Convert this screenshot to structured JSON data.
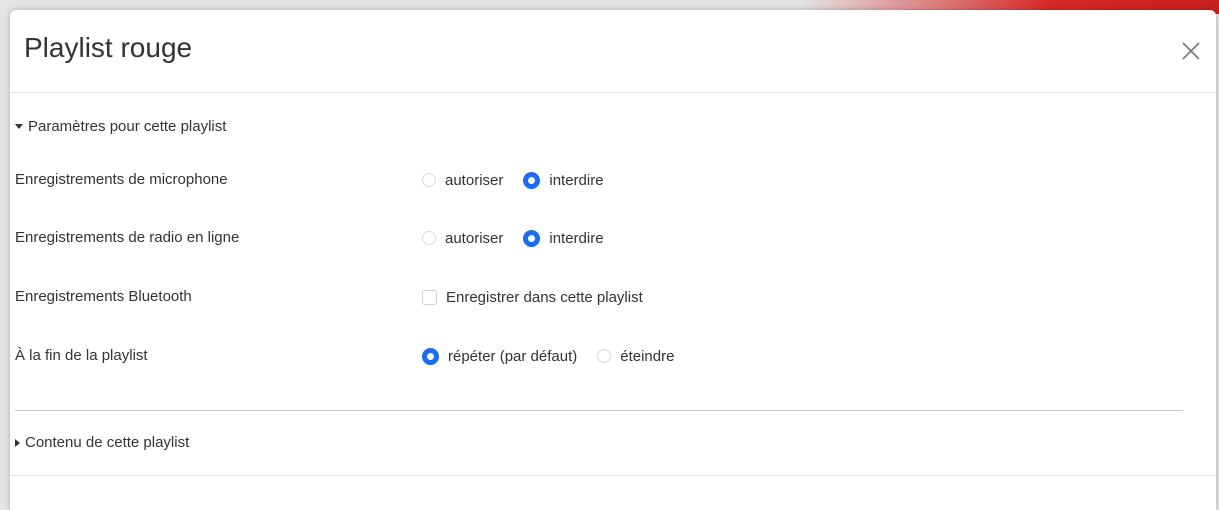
{
  "modal": {
    "title": "Playlist rouge",
    "close_icon": "close-icon"
  },
  "settings_section": {
    "label": "Paramètres pour cette playlist",
    "expanded": true,
    "rows": [
      {
        "label": "Enregistrements de microphone",
        "type": "radio",
        "options": [
          {
            "label": "autoriser",
            "checked": false
          },
          {
            "label": "interdire",
            "checked": true
          }
        ]
      },
      {
        "label": "Enregistrements de radio en ligne",
        "type": "radio",
        "options": [
          {
            "label": "autoriser",
            "checked": false
          },
          {
            "label": "interdire",
            "checked": true
          }
        ]
      },
      {
        "label": "Enregistrements Bluetooth",
        "type": "checkbox",
        "options": [
          {
            "label": "Enregistrer dans cette playlist",
            "checked": false
          }
        ]
      },
      {
        "label": "À la fin de la playlist",
        "type": "radio",
        "options": [
          {
            "label": "répéter (par défaut)",
            "checked": true
          },
          {
            "label": "éteindre",
            "checked": false
          }
        ]
      }
    ]
  },
  "content_section": {
    "label": "Contenu de cette playlist",
    "expanded": false
  },
  "colors": {
    "accent": "#1a6cf0",
    "backdrop_accent": "#d62828"
  }
}
